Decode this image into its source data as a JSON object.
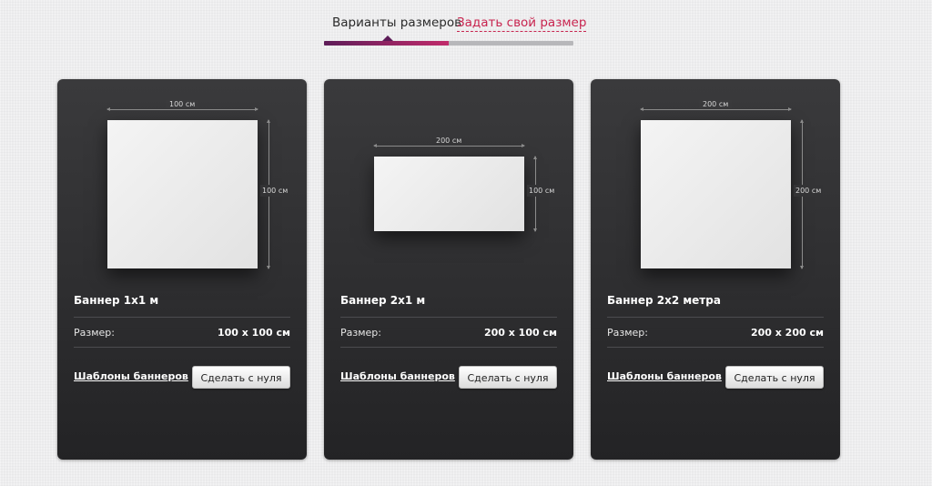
{
  "tabs": {
    "active_label": "Варианты размеров",
    "link_label": "Задать свой размер"
  },
  "colors": {
    "accent": "#c8244f",
    "tab_fill": "#5d1c58"
  },
  "cards": [
    {
      "title": "Баннер 1х1 м",
      "width_label": "100 см",
      "height_label": "100 см",
      "size_label": "Размер:",
      "size_value": "100 x 100 см",
      "templates_link": "Шаблоны баннеров",
      "make_button": "Сделать с нуля"
    },
    {
      "title": "Баннер 2х1 м",
      "width_label": "200 см",
      "height_label": "100 см",
      "size_label": "Размер:",
      "size_value": "200 x 100 см",
      "templates_link": "Шаблоны баннеров",
      "make_button": "Сделать с нуля"
    },
    {
      "title": "Баннер 2х2 метра",
      "width_label": "200 см",
      "height_label": "200 см",
      "size_label": "Размер:",
      "size_value": "200 x 200 см",
      "templates_link": "Шаблоны баннеров",
      "make_button": "Сделать с нуля"
    }
  ]
}
